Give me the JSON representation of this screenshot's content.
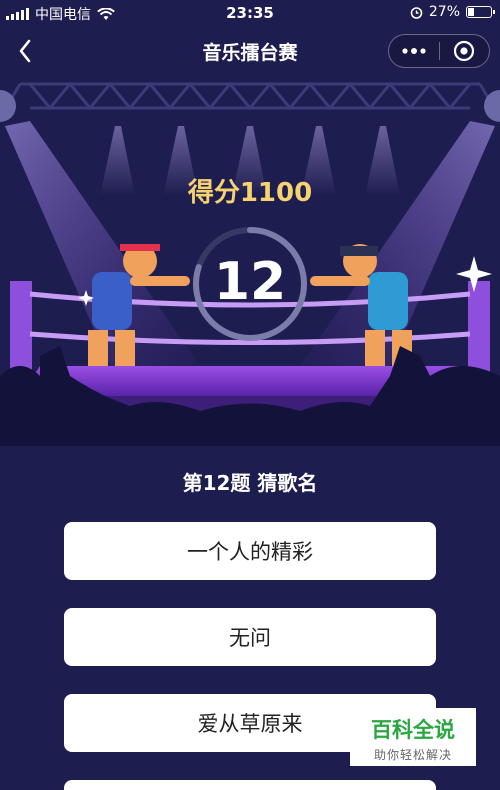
{
  "status_bar": {
    "carrier": "中国电信",
    "time": "23:35",
    "battery_percent": "27%",
    "battery_level": 0.27
  },
  "nav": {
    "title": "音乐擂台赛"
  },
  "game": {
    "score_text": "得分1100",
    "countdown": "12",
    "countdown_fraction": 0.8,
    "question": "第12题  猜歌名",
    "options": [
      "一个人的精彩",
      "无问",
      "爱从草原来",
      ""
    ]
  },
  "watermark": {
    "title": "百科全说",
    "subtitle": "助你轻松解决"
  },
  "colors": {
    "background": "#1d1d4f",
    "score": "#f6d36e",
    "stage_purple": "#7b3fd0",
    "watermark_green": "#2aa742"
  }
}
